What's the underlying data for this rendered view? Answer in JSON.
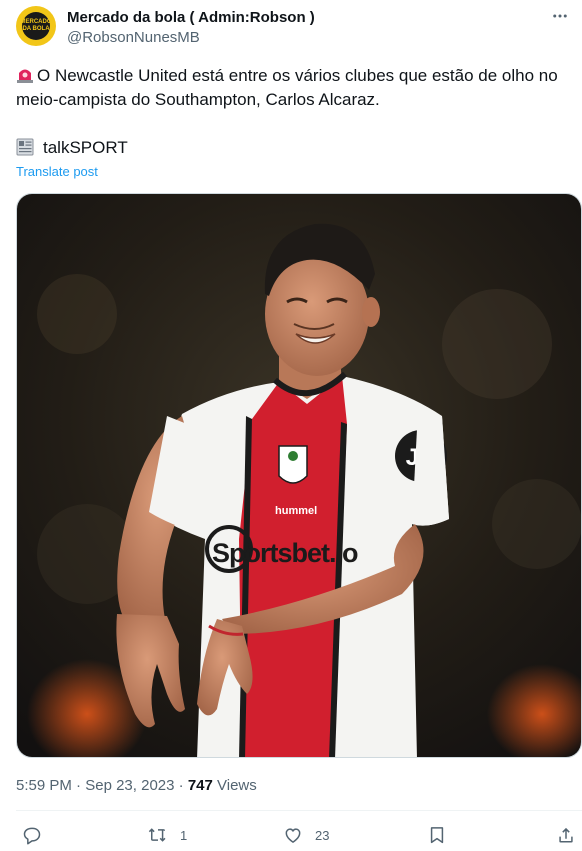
{
  "author": {
    "display_name": "Mercado da bola ( Admin:Robson )",
    "handle": "@RobsonNunesMB",
    "avatar_text": "MERCADO DA BOLA"
  },
  "post": {
    "text": "O Newcastle United está entre os vários clubes que estão de olho no meio-campista do Southampton, Carlos Alcaraz.",
    "source": "talkSPORT",
    "translate_label": "Translate post",
    "time": "5:59 PM",
    "date": "Sep 23, 2023",
    "views_count": "747",
    "views_label": "Views"
  },
  "image": {
    "sponsor_text": "Sportsbet.io",
    "sleeve_logo": "JD",
    "kit_brand": "hummel"
  },
  "actions": {
    "replies": "",
    "reposts": "1",
    "likes": "23"
  },
  "icons": {
    "siren": "siren-icon",
    "newspaper": "newspaper-icon"
  },
  "colors": {
    "link": "#1d9bf0",
    "secondary_text": "#536471",
    "primary_text": "#0f1419"
  }
}
